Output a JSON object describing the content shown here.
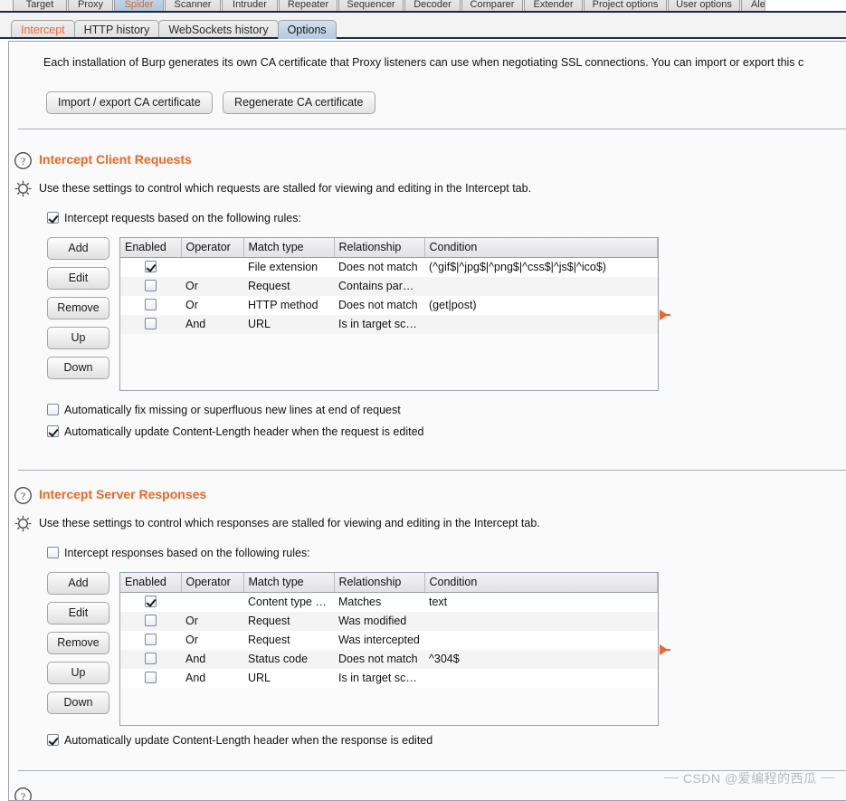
{
  "window": {
    "top_tabs": [
      {
        "label": "Target",
        "selected": false
      },
      {
        "label": "Proxy",
        "selected": false
      },
      {
        "label": "Spider",
        "selected": true
      },
      {
        "label": "Scanner",
        "selected": false
      },
      {
        "label": "Intruder",
        "selected": false
      },
      {
        "label": "Repeater",
        "selected": false
      },
      {
        "label": "Sequencer",
        "selected": false
      },
      {
        "label": "Decoder",
        "selected": false
      },
      {
        "label": "Comparer",
        "selected": false
      },
      {
        "label": "Extender",
        "selected": false
      },
      {
        "label": "Project options",
        "selected": false
      },
      {
        "label": "User options",
        "selected": false
      },
      {
        "label": "Alerts",
        "selected": false
      }
    ]
  },
  "subtabs": [
    {
      "label": "Intercept",
      "active": false,
      "accent": true
    },
    {
      "label": "HTTP history",
      "active": false,
      "accent": false
    },
    {
      "label": "WebSockets history",
      "active": false,
      "accent": false
    },
    {
      "label": "Options",
      "active": true,
      "accent": false
    }
  ],
  "ca": {
    "intro": "Each installation of Burp generates its own CA certificate that Proxy listeners can use when negotiating SSL connections. You can import or export this c",
    "import_export_label": "Import / export CA certificate",
    "regenerate_label": "Regenerate CA certificate"
  },
  "client_requests": {
    "title": "Intercept Client Requests",
    "description": "Use these settings to control which requests are stalled for viewing and editing in the Intercept tab.",
    "enable_checkbox": {
      "label": "Intercept requests based on the following rules:",
      "checked": true
    },
    "buttons": [
      "Add",
      "Edit",
      "Remove",
      "Up",
      "Down"
    ],
    "columns": [
      "Enabled",
      "Operator",
      "Match type",
      "Relationship",
      "Condition"
    ],
    "rows": [
      {
        "enabled": true,
        "operator": "",
        "match_type": "File extension",
        "relationship": "Does not match",
        "condition": "(^gif$|^jpg$|^png$|^css$|^js$|^ico$)"
      },
      {
        "enabled": false,
        "operator": "Or",
        "match_type": "Request",
        "relationship": "Contains parameters",
        "condition": ""
      },
      {
        "enabled": false,
        "operator": "Or",
        "match_type": "HTTP method",
        "relationship": "Does not match",
        "condition": "(get|post)"
      },
      {
        "enabled": false,
        "operator": "And",
        "match_type": "URL",
        "relationship": "Is in target scope",
        "condition": ""
      }
    ],
    "options": [
      {
        "label": "Automatically fix missing or superfluous new lines at end of request",
        "checked": false
      },
      {
        "label": "Automatically update Content-Length header when the request is edited",
        "checked": true
      }
    ]
  },
  "server_responses": {
    "title": "Intercept Server Responses",
    "description": "Use these settings to control which responses are stalled for viewing and editing in the Intercept tab.",
    "enable_checkbox": {
      "label": "Intercept responses based on the following rules:",
      "checked": false
    },
    "buttons": [
      "Add",
      "Edit",
      "Remove",
      "Up",
      "Down"
    ],
    "columns": [
      "Enabled",
      "Operator",
      "Match type",
      "Relationship",
      "Condition"
    ],
    "rows": [
      {
        "enabled": true,
        "operator": "",
        "match_type": "Content type h...",
        "relationship": "Matches",
        "condition": "text"
      },
      {
        "enabled": false,
        "operator": "Or",
        "match_type": "Request",
        "relationship": "Was modified",
        "condition": ""
      },
      {
        "enabled": false,
        "operator": "Or",
        "match_type": "Request",
        "relationship": "Was intercepted",
        "condition": ""
      },
      {
        "enabled": false,
        "operator": "And",
        "match_type": "Status code",
        "relationship": "Does not match",
        "condition": "^304$"
      },
      {
        "enabled": false,
        "operator": "And",
        "match_type": "URL",
        "relationship": "Is in target scope",
        "condition": ""
      }
    ],
    "options": [
      {
        "label": "Automatically update Content-Length header when the response is edited",
        "checked": true
      }
    ]
  },
  "watermark": "CSDN @爱编程的西瓜",
  "colors": {
    "accent": "#f26522",
    "marker": "#f2622a",
    "tab_active": "#b4cade",
    "panel_bg": "#fafafa"
  }
}
